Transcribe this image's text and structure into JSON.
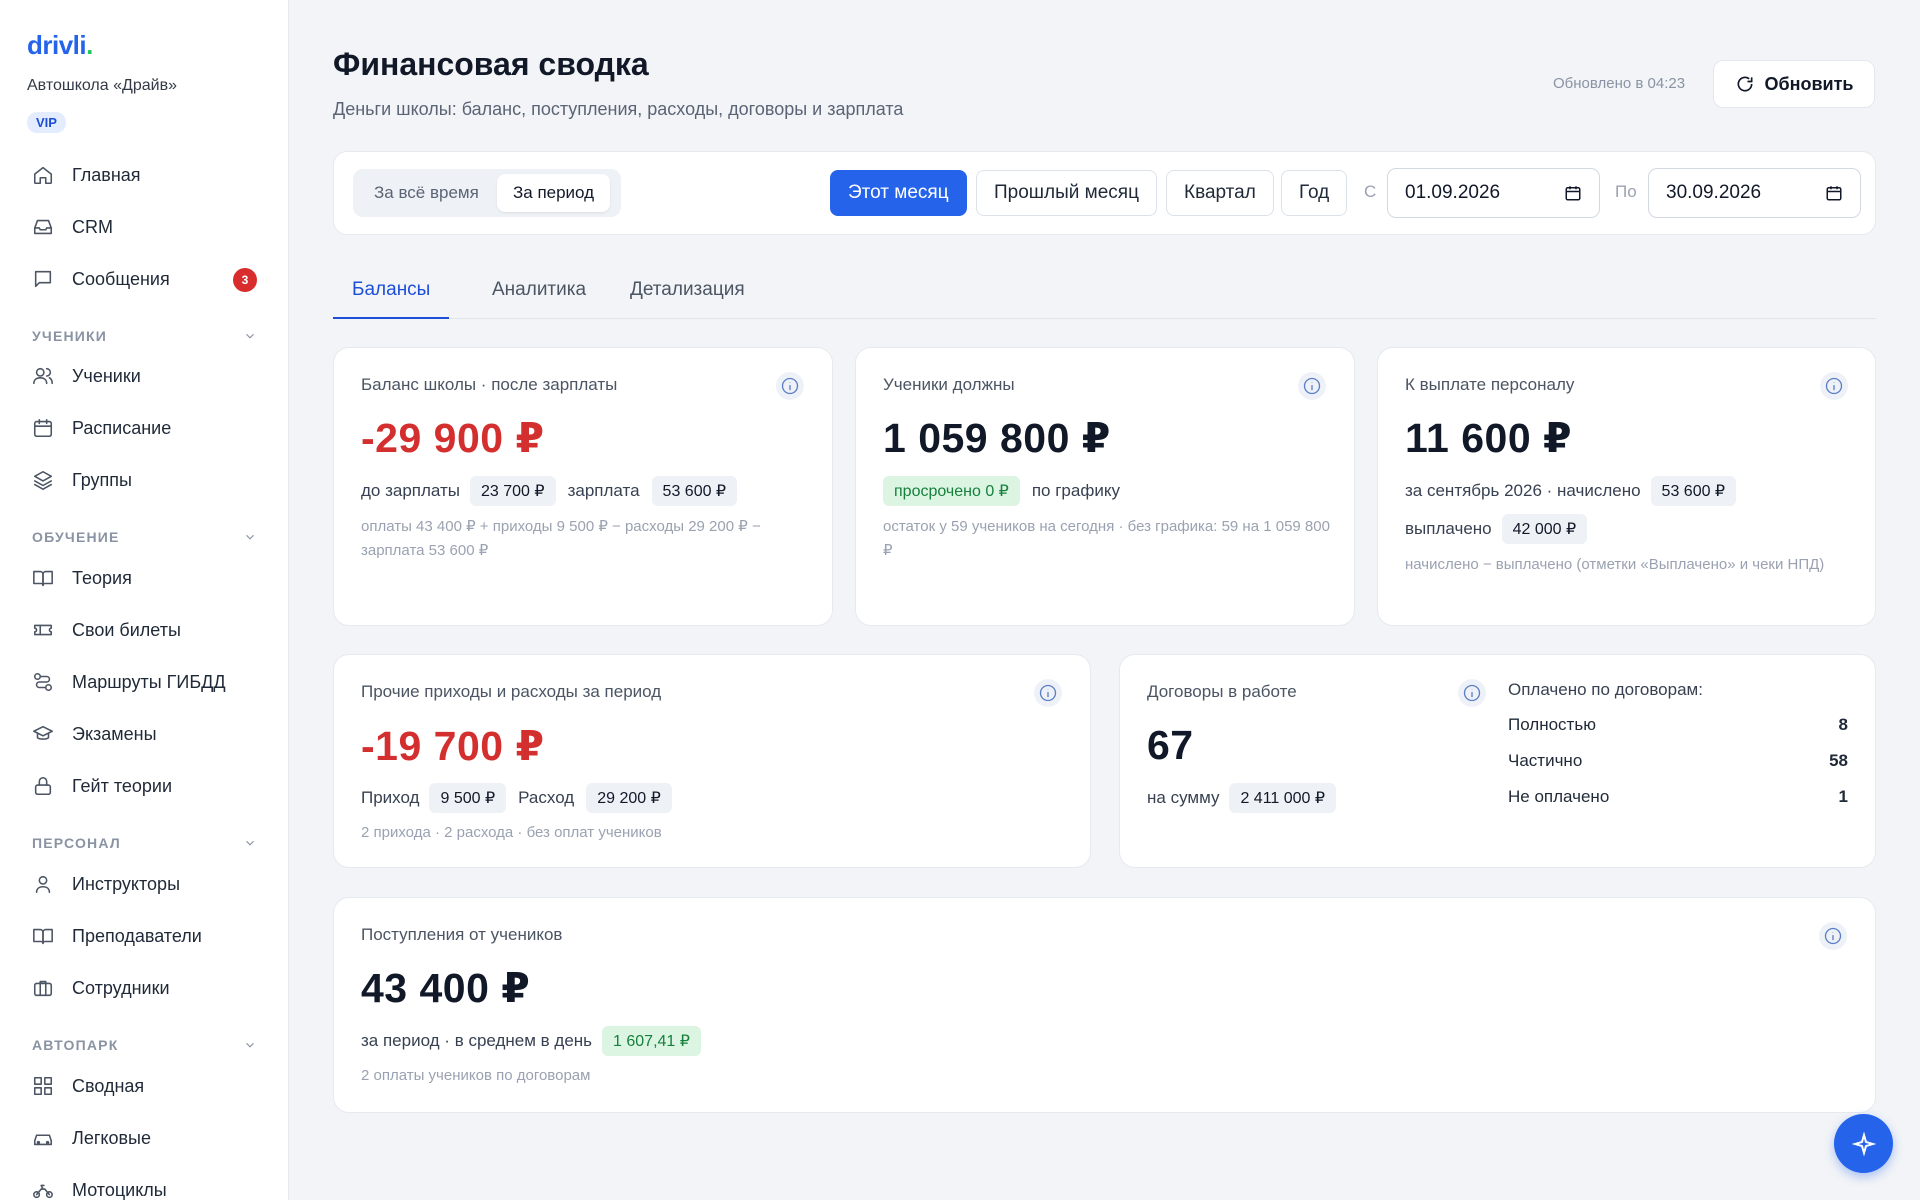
{
  "sidebar": {
    "logo_main": "drivli",
    "logo_dot": ".",
    "school": "Автошкола «Драйв»",
    "badge": "VIP",
    "items": {
      "home": "Главная",
      "crm": "CRM",
      "messages": "Сообщения",
      "messages_count": "3",
      "students": "Ученики",
      "schedule": "Расписание",
      "groups": "Группы",
      "theory": "Теория",
      "tickets": "Свои билеты",
      "routes": "Маршруты ГИБДД",
      "exams": "Экзамены",
      "gate": "Гейт теории",
      "instructors": "Инструкторы",
      "teachers": "Преподаватели",
      "employees": "Сотрудники",
      "summary": "Сводная",
      "cars": "Легковые",
      "moto": "Мотоциклы"
    },
    "sections": {
      "students": "УЧЕНИКИ",
      "learning": "ОБУЧЕНИЕ",
      "staff": "ПЕРСОНАЛ",
      "fleet": "АВТОПАРК"
    }
  },
  "header": {
    "title": "Финансовая сводка",
    "subtitle": "Деньги школы: баланс, поступления, расходы, договоры и зарплата",
    "updated": "Обновлено в 04:23",
    "refresh": "Обновить"
  },
  "filters": {
    "all_time": "За всё время",
    "period": "За период",
    "this_month": "Этот месяц",
    "last_month": "Прошлый месяц",
    "quarter": "Квартал",
    "year": "Год",
    "from_label": "С",
    "to_label": "По",
    "from_value": "01.09.2026",
    "to_value": "30.09.2026"
  },
  "tabs": {
    "balances": "Балансы",
    "analytics": "Аналитика",
    "details": "Детализация"
  },
  "balance": {
    "label": "Баланс школы · после зарплаты",
    "value": "-29 900 ₽",
    "before_label": "до зарплаты",
    "before_value": "23 700 ₽",
    "salary_label": "зарплата",
    "salary_value": "53 600 ₽",
    "note": "оплаты 43 400 ₽ + приходы 9 500 ₽ − расходы 29 200 ₽ − зарплата 53 600 ₽"
  },
  "debts": {
    "label": "Ученики должны",
    "value": "1 059 800 ₽",
    "overdue": "просрочено 0 ₽",
    "schedule": "по графику",
    "note": "остаток у 59 учеников на сегодня · без графика: 59 на 1 059 800 ₽"
  },
  "payroll": {
    "label": "К выплате персоналу",
    "value": "11 600 ₽",
    "accrued_label": "за сентябрь 2026 · начислено",
    "accrued_value": "53 600 ₽",
    "paid_label": "выплачено",
    "paid_value": "42 000 ₽",
    "note": "начислено − выплачено (отметки «Выплачено» и чеки НПД)"
  },
  "other": {
    "label": "Прочие приходы и расходы за период",
    "value": "-19 700 ₽",
    "income_label": "Приход",
    "income_value": "9 500 ₽",
    "expense_label": "Расход",
    "expense_value": "29 200 ₽",
    "note": "2 прихода · 2 расхода · без оплат учеников"
  },
  "contracts": {
    "label": "Договоры в работе",
    "value": "67",
    "sum_label": "на сумму",
    "sum_value": "2 411 000 ₽",
    "paid_head": "Оплачено по договорам:",
    "full_label": "Полностью",
    "full_value": "8",
    "partial_label": "Частично",
    "partial_value": "58",
    "unpaid_label": "Не оплачено",
    "unpaid_value": "1"
  },
  "income": {
    "label": "Поступления от учеников",
    "value": "43 400 ₽",
    "avg_label": "за период · в среднем в день",
    "avg_value": "1 607,41 ₽",
    "note": "2 оплаты учеников по договорам"
  }
}
